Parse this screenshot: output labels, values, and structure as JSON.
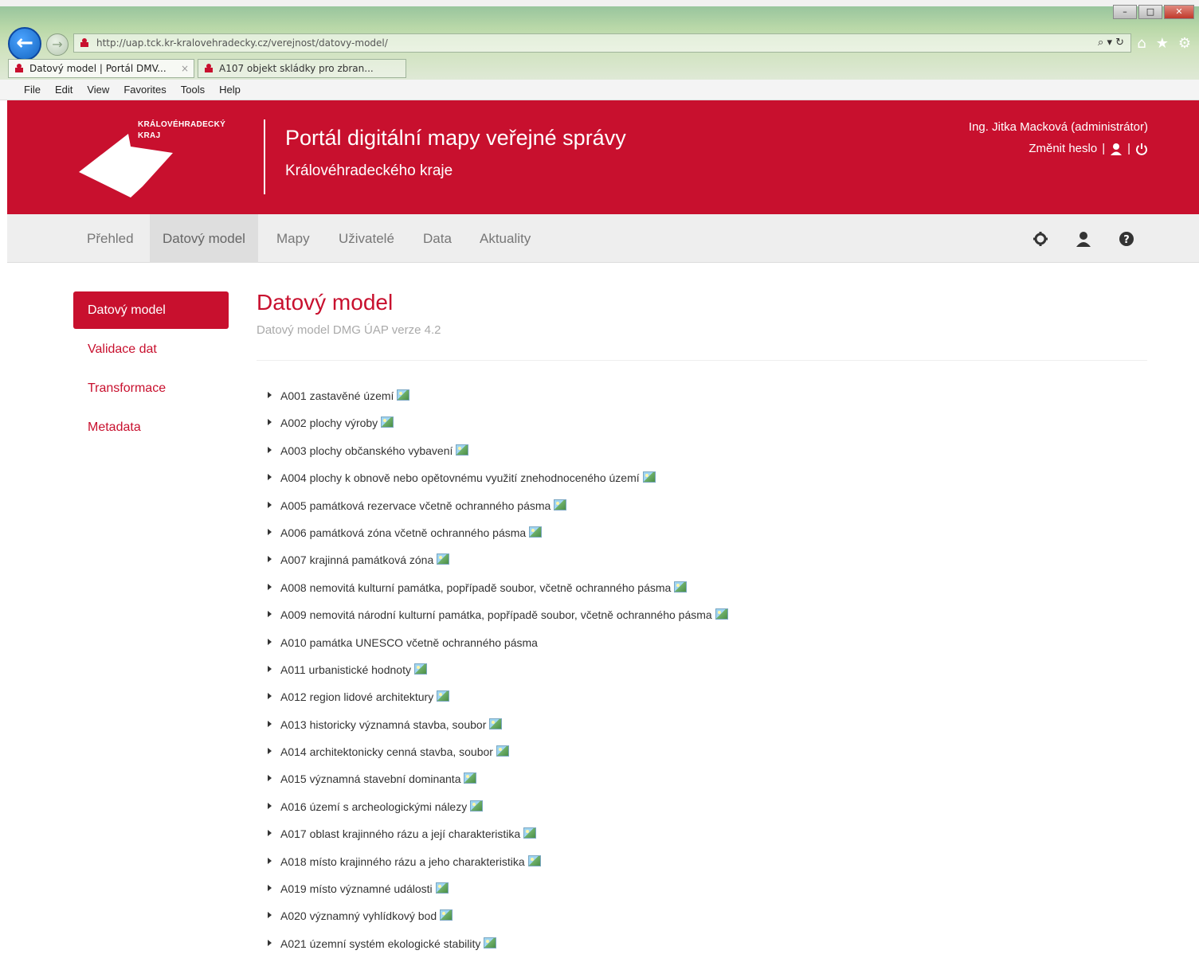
{
  "browser": {
    "url": "http://uap.tck.kr-kralovehradecky.cz/verejnost/datovy-model/",
    "tabs": [
      {
        "label": "Datový model | Portál DMV...",
        "active": true
      },
      {
        "label": "A107 objekt skládky pro zbran...",
        "active": false
      }
    ],
    "menu": [
      "File",
      "Edit",
      "View",
      "Favorites",
      "Tools",
      "Help"
    ],
    "address_tools": "⌕ ▾ ↻"
  },
  "header": {
    "logo_text_line1": "KRÁLOVÉHRADECKÝ",
    "logo_text_line2": "KRAJ",
    "title": "Portál digitální mapy veřejné správy",
    "subtitle": "Královéhradeckého kraje",
    "user_name": "Ing. Jitka Macková (administrátor)",
    "change_password": "Změnit heslo",
    "separator": "|",
    "brand_color": "#c8102e"
  },
  "nav": {
    "items": [
      {
        "label": "Přehled",
        "active": false
      },
      {
        "label": "Datový model",
        "active": true
      },
      {
        "label": "Mapy",
        "active": false
      },
      {
        "label": "Uživatelé",
        "active": false
      },
      {
        "label": "Data",
        "active": false
      },
      {
        "label": "Aktuality",
        "active": false
      }
    ],
    "icons": [
      "gear-icon",
      "user-icon",
      "help-icon"
    ]
  },
  "sidebar": {
    "items": [
      {
        "label": "Datový model",
        "active": true
      },
      {
        "label": "Validace dat",
        "active": false
      },
      {
        "label": "Transformace",
        "active": false
      },
      {
        "label": "Metadata",
        "active": false
      }
    ]
  },
  "content": {
    "title": "Datový model",
    "subtitle": "Datový model DMG ÚAP verze 4.2",
    "items": [
      {
        "label": "A001 zastavěné území",
        "has_icon": true
      },
      {
        "label": "A002 plochy výroby",
        "has_icon": true
      },
      {
        "label": "A003 plochy občanského vybavení",
        "has_icon": true
      },
      {
        "label": "A004 plochy k obnově nebo opětovnému využití znehodnoceného území",
        "has_icon": true
      },
      {
        "label": "A005 památková rezervace včetně ochranného pásma",
        "has_icon": true
      },
      {
        "label": "A006 památková zóna včetně ochranného pásma",
        "has_icon": true
      },
      {
        "label": "A007 krajinná památková zóna",
        "has_icon": true
      },
      {
        "label": "A008 nemovitá kulturní památka, popřípadě soubor, včetně ochranného pásma",
        "has_icon": true
      },
      {
        "label": "A009 nemovitá národní kulturní památka, popřípadě soubor, včetně ochranného pásma",
        "has_icon": true
      },
      {
        "label": "A010 památka UNESCO včetně ochranného pásma",
        "has_icon": false
      },
      {
        "label": "A011 urbanistické hodnoty",
        "has_icon": true
      },
      {
        "label": "A012 region lidové architektury",
        "has_icon": true
      },
      {
        "label": "A013 historicky významná stavba, soubor",
        "has_icon": true
      },
      {
        "label": "A014 architektonicky cenná stavba, soubor",
        "has_icon": true
      },
      {
        "label": "A015 významná stavební dominanta",
        "has_icon": true
      },
      {
        "label": "A016 území s archeologickými nálezy",
        "has_icon": true
      },
      {
        "label": "A017 oblast krajinného rázu a její charakteristika",
        "has_icon": true
      },
      {
        "label": "A018 místo krajinného rázu a jeho charakteristika",
        "has_icon": true
      },
      {
        "label": "A019 místo významné události",
        "has_icon": true
      },
      {
        "label": "A020 významný vyhlídkový bod",
        "has_icon": true
      },
      {
        "label": "A021 územní systém ekologické stability",
        "has_icon": true
      }
    ]
  }
}
